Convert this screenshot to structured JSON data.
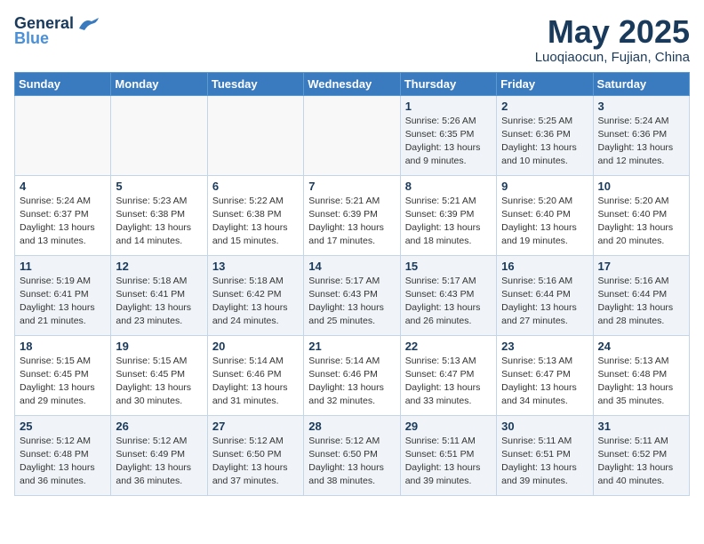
{
  "logo": {
    "general": "General",
    "blue": "Blue"
  },
  "title": "May 2025",
  "location": "Luoqiaocun, Fujian, China",
  "days_of_week": [
    "Sunday",
    "Monday",
    "Tuesday",
    "Wednesday",
    "Thursday",
    "Friday",
    "Saturday"
  ],
  "weeks": [
    [
      {
        "day": "",
        "info": ""
      },
      {
        "day": "",
        "info": ""
      },
      {
        "day": "",
        "info": ""
      },
      {
        "day": "",
        "info": ""
      },
      {
        "day": "1",
        "info": "Sunrise: 5:26 AM\nSunset: 6:35 PM\nDaylight: 13 hours\nand 9 minutes."
      },
      {
        "day": "2",
        "info": "Sunrise: 5:25 AM\nSunset: 6:36 PM\nDaylight: 13 hours\nand 10 minutes."
      },
      {
        "day": "3",
        "info": "Sunrise: 5:24 AM\nSunset: 6:36 PM\nDaylight: 13 hours\nand 12 minutes."
      }
    ],
    [
      {
        "day": "4",
        "info": "Sunrise: 5:24 AM\nSunset: 6:37 PM\nDaylight: 13 hours\nand 13 minutes."
      },
      {
        "day": "5",
        "info": "Sunrise: 5:23 AM\nSunset: 6:38 PM\nDaylight: 13 hours\nand 14 minutes."
      },
      {
        "day": "6",
        "info": "Sunrise: 5:22 AM\nSunset: 6:38 PM\nDaylight: 13 hours\nand 15 minutes."
      },
      {
        "day": "7",
        "info": "Sunrise: 5:21 AM\nSunset: 6:39 PM\nDaylight: 13 hours\nand 17 minutes."
      },
      {
        "day": "8",
        "info": "Sunrise: 5:21 AM\nSunset: 6:39 PM\nDaylight: 13 hours\nand 18 minutes."
      },
      {
        "day": "9",
        "info": "Sunrise: 5:20 AM\nSunset: 6:40 PM\nDaylight: 13 hours\nand 19 minutes."
      },
      {
        "day": "10",
        "info": "Sunrise: 5:20 AM\nSunset: 6:40 PM\nDaylight: 13 hours\nand 20 minutes."
      }
    ],
    [
      {
        "day": "11",
        "info": "Sunrise: 5:19 AM\nSunset: 6:41 PM\nDaylight: 13 hours\nand 21 minutes."
      },
      {
        "day": "12",
        "info": "Sunrise: 5:18 AM\nSunset: 6:41 PM\nDaylight: 13 hours\nand 23 minutes."
      },
      {
        "day": "13",
        "info": "Sunrise: 5:18 AM\nSunset: 6:42 PM\nDaylight: 13 hours\nand 24 minutes."
      },
      {
        "day": "14",
        "info": "Sunrise: 5:17 AM\nSunset: 6:43 PM\nDaylight: 13 hours\nand 25 minutes."
      },
      {
        "day": "15",
        "info": "Sunrise: 5:17 AM\nSunset: 6:43 PM\nDaylight: 13 hours\nand 26 minutes."
      },
      {
        "day": "16",
        "info": "Sunrise: 5:16 AM\nSunset: 6:44 PM\nDaylight: 13 hours\nand 27 minutes."
      },
      {
        "day": "17",
        "info": "Sunrise: 5:16 AM\nSunset: 6:44 PM\nDaylight: 13 hours\nand 28 minutes."
      }
    ],
    [
      {
        "day": "18",
        "info": "Sunrise: 5:15 AM\nSunset: 6:45 PM\nDaylight: 13 hours\nand 29 minutes."
      },
      {
        "day": "19",
        "info": "Sunrise: 5:15 AM\nSunset: 6:45 PM\nDaylight: 13 hours\nand 30 minutes."
      },
      {
        "day": "20",
        "info": "Sunrise: 5:14 AM\nSunset: 6:46 PM\nDaylight: 13 hours\nand 31 minutes."
      },
      {
        "day": "21",
        "info": "Sunrise: 5:14 AM\nSunset: 6:46 PM\nDaylight: 13 hours\nand 32 minutes."
      },
      {
        "day": "22",
        "info": "Sunrise: 5:13 AM\nSunset: 6:47 PM\nDaylight: 13 hours\nand 33 minutes."
      },
      {
        "day": "23",
        "info": "Sunrise: 5:13 AM\nSunset: 6:47 PM\nDaylight: 13 hours\nand 34 minutes."
      },
      {
        "day": "24",
        "info": "Sunrise: 5:13 AM\nSunset: 6:48 PM\nDaylight: 13 hours\nand 35 minutes."
      }
    ],
    [
      {
        "day": "25",
        "info": "Sunrise: 5:12 AM\nSunset: 6:48 PM\nDaylight: 13 hours\nand 36 minutes."
      },
      {
        "day": "26",
        "info": "Sunrise: 5:12 AM\nSunset: 6:49 PM\nDaylight: 13 hours\nand 36 minutes."
      },
      {
        "day": "27",
        "info": "Sunrise: 5:12 AM\nSunset: 6:50 PM\nDaylight: 13 hours\nand 37 minutes."
      },
      {
        "day": "28",
        "info": "Sunrise: 5:12 AM\nSunset: 6:50 PM\nDaylight: 13 hours\nand 38 minutes."
      },
      {
        "day": "29",
        "info": "Sunrise: 5:11 AM\nSunset: 6:51 PM\nDaylight: 13 hours\nand 39 minutes."
      },
      {
        "day": "30",
        "info": "Sunrise: 5:11 AM\nSunset: 6:51 PM\nDaylight: 13 hours\nand 39 minutes."
      },
      {
        "day": "31",
        "info": "Sunrise: 5:11 AM\nSunset: 6:52 PM\nDaylight: 13 hours\nand 40 minutes."
      }
    ]
  ]
}
